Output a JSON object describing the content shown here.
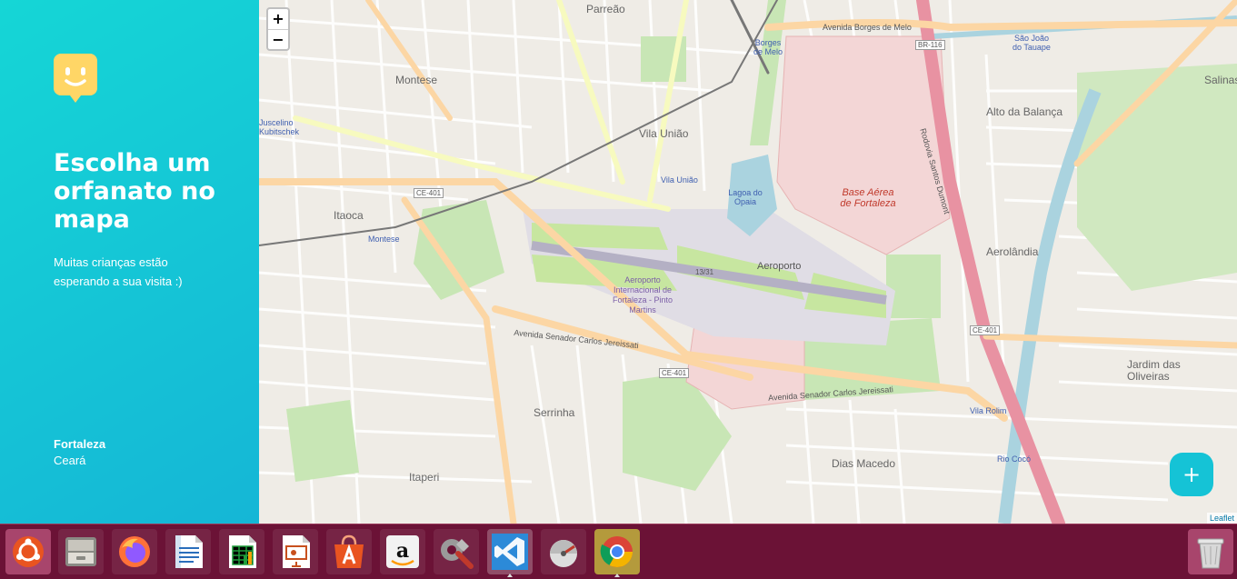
{
  "sidebar": {
    "title": "Escolha um orfanato no mapa",
    "subtitle": "Muitas crianças estão esperando a sua visita :)",
    "city": "Fortaleza",
    "state": "Ceará",
    "accent": "#15C3D6",
    "logo_color": "#FFD666"
  },
  "map": {
    "zoom_in": "+",
    "zoom_out": "−",
    "attribution": "Leaflet",
    "add_button": "+",
    "labels": {
      "parreao": "Parreão",
      "montese_top": "Montese",
      "vila_uniao": "Vila União",
      "vila_uniao_station": "Vila União",
      "itaoca": "Itaoca",
      "montese": "Montese",
      "serrinha": "Serrinha",
      "itaperi": "Itaperi",
      "dias_macedo": "Dias Macedo",
      "aeroporto": "Aeroporto",
      "aeroporto_intl": "Aeroporto Internacional de Fortaleza - Pinto Martins",
      "base_aerea": "Base Aérea de Fortaleza",
      "alto_balanca": "Alto da Balança",
      "aerolandia": "Aerolândia",
      "jardim_oliveiras": "Jardim das Oliveiras",
      "sao_joao_tauape": "São João do Tauape",
      "borges_melo": "Borges de Melo",
      "salinas": "Salinas",
      "av_borges_melo": "Avenida Borges de Melo",
      "av_senador_top": "Avenida Senador Carlos Jereissati",
      "av_senador_bottom": "Avenida Senador Carlos Jereissati",
      "ce401_a": "CE-401",
      "ce401_b": "CE-401",
      "ce401_c": "CE-401",
      "br116": "BR-116",
      "rodovia": "Rodovia Santos Dumont",
      "runway": "13/31",
      "lagoa": "Lagoa do Opaia",
      "vila_rolim": "Vila Rolim",
      "rio_coco": "Rio Cocó",
      "juscelino": "Juscelino Kubitschek"
    }
  },
  "dock": {
    "items": [
      {
        "name": "ubuntu-dash-icon"
      },
      {
        "name": "files-icon"
      },
      {
        "name": "firefox-icon"
      },
      {
        "name": "libreoffice-writer-icon"
      },
      {
        "name": "libreoffice-calc-icon"
      },
      {
        "name": "libreoffice-impress-icon"
      },
      {
        "name": "software-center-icon"
      },
      {
        "name": "amazon-icon"
      },
      {
        "name": "system-settings-icon"
      },
      {
        "name": "vscode-icon"
      },
      {
        "name": "update-manager-icon"
      },
      {
        "name": "chrome-icon"
      },
      {
        "name": "trash-icon"
      }
    ],
    "background": "#6b1236"
  }
}
